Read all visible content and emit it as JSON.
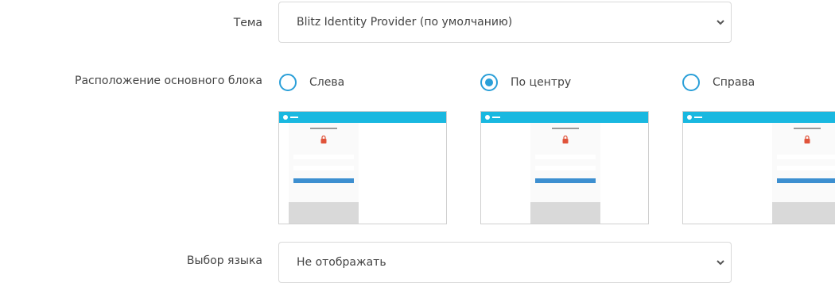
{
  "theme": {
    "label": "Тема",
    "value": "Blitz Identity Provider (по умолчанию)"
  },
  "layout": {
    "label": "Расположение основного блока",
    "options": [
      {
        "label": "Слева",
        "checked": false
      },
      {
        "label": "По центру",
        "checked": true
      },
      {
        "label": "Справа",
        "checked": false
      }
    ]
  },
  "language": {
    "label": "Выбор языка",
    "value": "Не отображать"
  },
  "colors": {
    "accent": "#2a9fd8",
    "preview_bar": "#19b8e0",
    "preview_button": "#3d8fd0",
    "lock": "#e0533a"
  },
  "icons": {
    "select_arrow": "chevron-down-icon",
    "preview_lock": "lock-icon"
  }
}
